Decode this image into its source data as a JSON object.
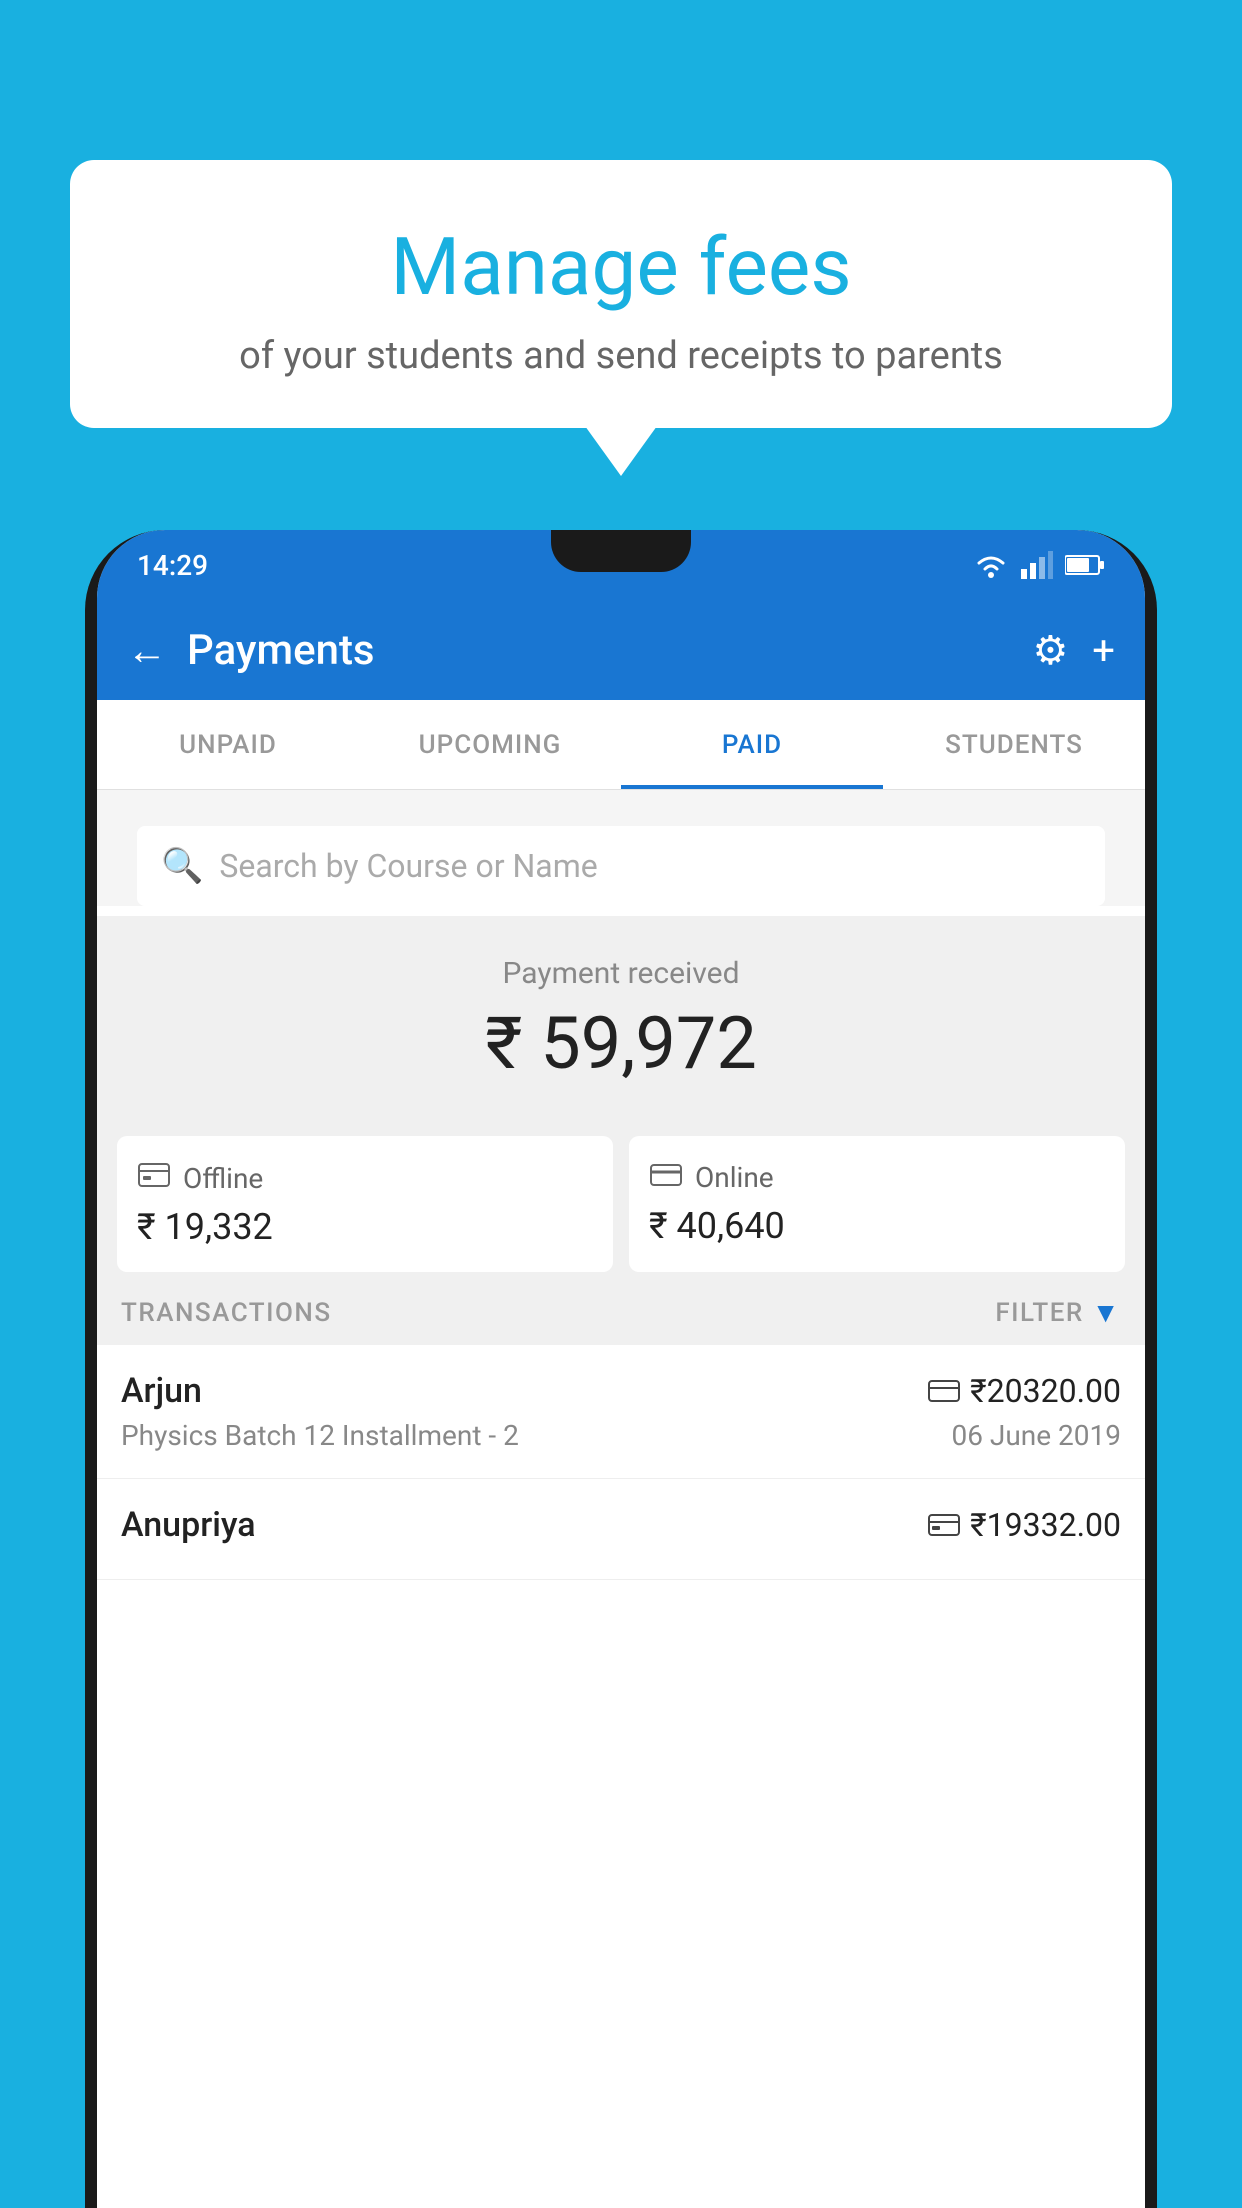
{
  "background": {
    "color": "#19b0e0"
  },
  "speech_bubble": {
    "title": "Manage fees",
    "subtitle": "of your students and send receipts to parents"
  },
  "status_bar": {
    "time": "14:29"
  },
  "app_bar": {
    "title": "Payments",
    "back_label": "←",
    "gear_label": "⚙",
    "plus_label": "+"
  },
  "tabs": [
    {
      "label": "UNPAID",
      "active": false
    },
    {
      "label": "UPCOMING",
      "active": false
    },
    {
      "label": "PAID",
      "active": true
    },
    {
      "label": "STUDENTS",
      "active": false
    }
  ],
  "search": {
    "placeholder": "Search by Course or Name"
  },
  "payment_summary": {
    "label": "Payment received",
    "amount": "₹ 59,972",
    "cards": [
      {
        "icon": "₹□",
        "label": "Offline",
        "amount": "₹ 19,332"
      },
      {
        "icon": "💳",
        "label": "Online",
        "amount": "₹ 40,640"
      }
    ]
  },
  "transactions": {
    "header": "TRANSACTIONS",
    "filter_label": "FILTER",
    "items": [
      {
        "name": "Arjun",
        "amount": "₹20320.00",
        "course": "Physics Batch 12 Installment - 2",
        "date": "06 June 2019",
        "payment_type": "card"
      },
      {
        "name": "Anupriya",
        "amount": "₹19332.00",
        "course": "",
        "date": "",
        "payment_type": "offline"
      }
    ]
  }
}
